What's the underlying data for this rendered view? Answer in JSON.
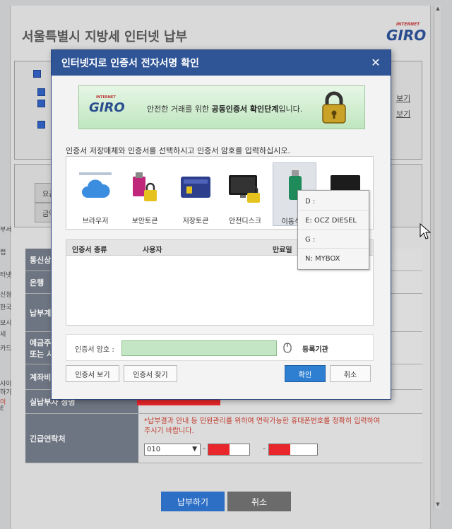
{
  "background": {
    "page_title": "서울특별시 지방세 인터넷 납부",
    "logo_small": "INTERNET",
    "logo": "GIRO",
    "side_links": [
      "보기",
      "보기"
    ],
    "summary_labels": [
      "요금",
      "금액"
    ],
    "left_strip_texts": [
      "부서",
      "랩",
      "터넷",
      "신청",
      "한국",
      "보시",
      "세",
      "카드",
      "사이",
      "하기",
      "이",
      "E"
    ],
    "table_rows": [
      {
        "label": "통신상태"
      },
      {
        "label": "은행"
      },
      {
        "label": "납부계좌"
      },
      {
        "label": "예금주\n또는 사"
      },
      {
        "label": "계좌비"
      },
      {
        "label": "실납부자 성명"
      },
      {
        "label": "긴급연락처"
      }
    ],
    "notice": "*납부결과 안내 등 민원관리를 위하여 연락가능한 휴대폰번호를 정확히 입력하여 주시기 바랍니다.",
    "phone_prefix": "010",
    "phone_dash": "-",
    "pay_button": "납부하기",
    "cancel_button": "취소",
    "colors": {
      "red_mask": "#e8262b",
      "pay_btn": "#2e6fc6",
      "cancel_btn": "#6b6b6b"
    }
  },
  "dialog": {
    "title": "인터넷지로 인증서 전자서명 확인",
    "close_label": "✕",
    "banner": {
      "logo_small": "INTERNET",
      "logo": "GIRO",
      "text_prefix": "안전한 거래를 위한 ",
      "text_bold": "공동인증서 확인단계",
      "text_suffix": "입니다."
    },
    "instruction": "인증서 저장매체와 인증서를 선택하시고 인증서 암호를 입력하십시오.",
    "media": [
      {
        "label": "브라우저",
        "icon": "cloud-icon"
      },
      {
        "label": "보안토큰",
        "icon": "security-token-icon"
      },
      {
        "label": "저장토큰",
        "icon": "storage-token-icon"
      },
      {
        "label": "안전디스크",
        "icon": "safe-disk-icon"
      },
      {
        "label": "이동식디",
        "icon": "usb-icon"
      },
      {
        "label": "",
        "icon": "monitor-icon"
      }
    ],
    "drive_menu": [
      "D :",
      "E: OCZ DIESEL",
      "G :",
      "N: MYBOX"
    ],
    "cert_columns": [
      "인증서 종류",
      "사용자",
      "만료일"
    ],
    "password_label": "인증서 암호 :",
    "register_label": "등록기관",
    "view_cert": "인증서 보기",
    "find_cert": "인증서 찾기",
    "ok": "확인",
    "cancel": "취소",
    "colors": {
      "header": "#2f5597",
      "password_bg": "#c4e6c4",
      "ok_btn": "#2e7fd1"
    }
  }
}
